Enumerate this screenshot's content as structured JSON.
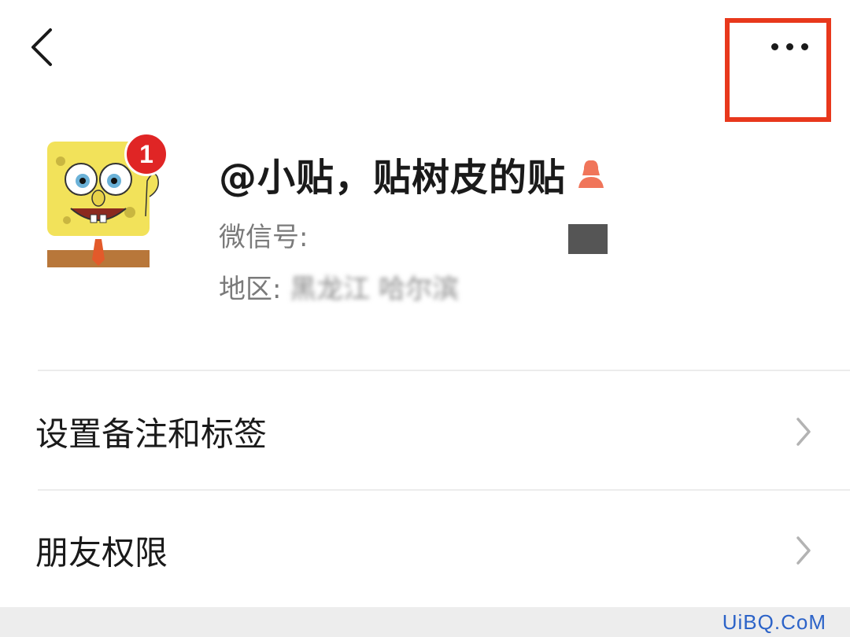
{
  "header": {
    "back_icon": "chevron-left-icon",
    "more_icon": "more-horizontal-icon",
    "highlight_color": "#e8381c"
  },
  "profile": {
    "avatar_icon": "spongebob-avatar",
    "unread_badge": "1",
    "nickname": "@小贴，贴树皮的贴",
    "gender_icon": "female-user-icon",
    "gender_color": "#f0755a",
    "wechat_id_label": "微信号:",
    "region_label": "地区:",
    "region_value": "黑龙江 哈尔滨"
  },
  "menu": {
    "items": [
      {
        "label": "设置备注和标签",
        "icon": "chevron-right-icon"
      },
      {
        "label": "朋友权限",
        "icon": "chevron-right-icon"
      }
    ]
  },
  "watermark": "UiBQ.CoM"
}
